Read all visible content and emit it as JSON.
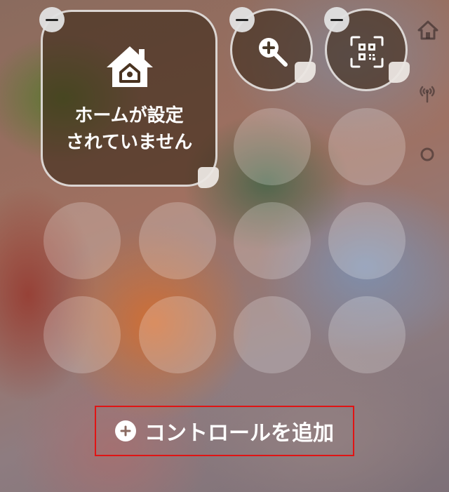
{
  "home_tile": {
    "label_line1": "ホームが設定",
    "label_line2": "されていません",
    "icon": "house-icon"
  },
  "controls": [
    {
      "name": "magnifier-control",
      "icon": "magnifier-plus-icon"
    },
    {
      "name": "code-scanner-control",
      "icon": "qr-scanner-icon"
    }
  ],
  "sidebar_icons": [
    "house-icon",
    "antenna-icon",
    "ring-icon"
  ],
  "add_button": {
    "label": "コントロールを追加",
    "icon": "plus-circle-icon"
  },
  "colors": {
    "highlight_border": "#e01414",
    "tile_stroke": "#ffffff"
  }
}
